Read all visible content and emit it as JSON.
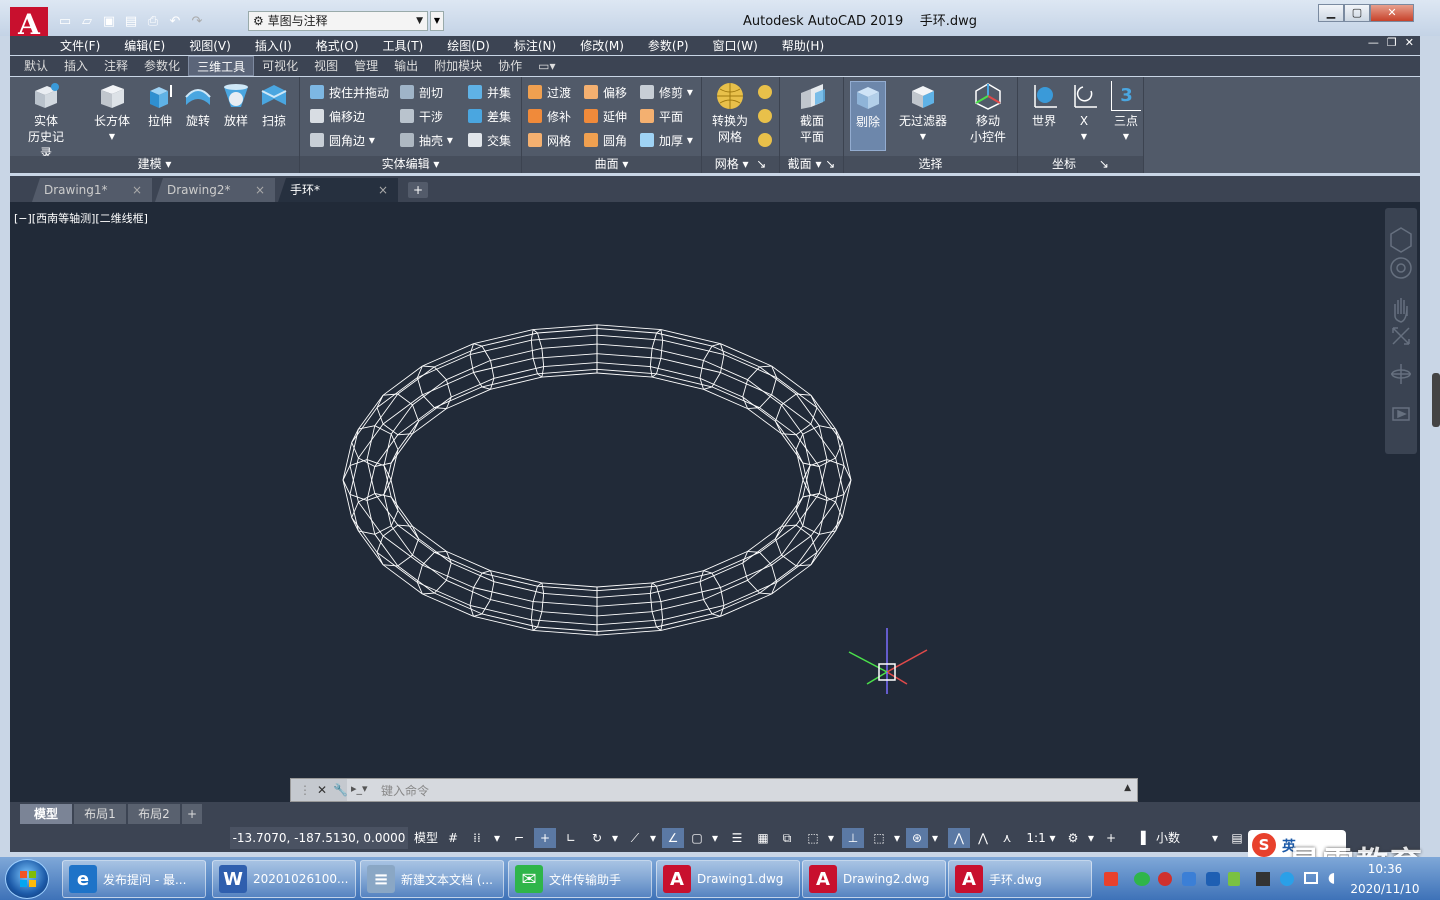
{
  "app": {
    "logo_letter": "A",
    "title": "Autodesk AutoCAD 2019",
    "filename": "手环.dwg",
    "workspace": "草图与注释"
  },
  "menubar": [
    "文件(F)",
    "编辑(E)",
    "视图(V)",
    "插入(I)",
    "格式(O)",
    "工具(T)",
    "绘图(D)",
    "标注(N)",
    "修改(M)",
    "参数(P)",
    "窗口(W)",
    "帮助(H)"
  ],
  "ribbon_tabs": [
    "默认",
    "插入",
    "注释",
    "参数化",
    "三维工具",
    "可视化",
    "视图",
    "管理",
    "输出",
    "附加模块",
    "协作"
  ],
  "ribbon": {
    "modeling": {
      "title": "建模",
      "history_label_1": "实体",
      "history_label_2": "历史记录",
      "box": "长方体",
      "extrude": "拉伸",
      "revolve": "旋转",
      "loft": "放样",
      "sweep": "扫掠"
    },
    "solid_edit": {
      "title": "实体编辑",
      "presspull": "按住并拖动",
      "offset_edge": "偏移边",
      "fillet_edge": "圆角边",
      "slice": "剖切",
      "interfere": "干涉",
      "shell": "抽壳",
      "union": "并集",
      "subtract": "差集",
      "intersect": "交集"
    },
    "surface": {
      "title": "曲面",
      "blend": "过渡",
      "patch": "修补",
      "network": "网格",
      "offset": "偏移",
      "extend": "延伸",
      "fillet": "圆角",
      "trim": "修剪",
      "planar": "平面",
      "thicken": "加厚"
    },
    "mesh": {
      "title": "网格",
      "convert_1": "转换为",
      "convert_2": "网格"
    },
    "section": {
      "title": "截面",
      "plane_1": "截面",
      "plane_2": "平面"
    },
    "selection": {
      "title": "选择",
      "cull": "剔除",
      "no_filter": "无过滤器",
      "gizmo_1": "移动",
      "gizmo_2": "小控件"
    },
    "coordinates": {
      "title": "坐标",
      "world": "世界",
      "x": "X",
      "three_point": "三点",
      "three_glyph": "3"
    }
  },
  "file_tabs": [
    {
      "label": "Drawing1*",
      "close": "×"
    },
    {
      "label": "Drawing2*",
      "close": "×"
    },
    {
      "label": "手环*",
      "close": "×"
    }
  ],
  "tab_add": "+",
  "viewport": {
    "label": "[−][西南等轴测][二维线框]"
  },
  "command": {
    "placeholder": "键入命令",
    "close": "✕"
  },
  "layout_tabs": [
    "模型",
    "布局1",
    "布局2"
  ],
  "layout_add": "+",
  "status": {
    "coords": "-13.7070, -187.5130, 0.0000",
    "model": "模型",
    "scale": "1:1",
    "units": "小数"
  },
  "taskbar": [
    {
      "label": "发布提问 - 最...",
      "icon": "ie-icon",
      "color": "#1e73c8",
      "glyph": "e"
    },
    {
      "label": "20201026100...",
      "icon": "word-icon",
      "color": "#2f5fae",
      "glyph": "W"
    },
    {
      "label": "新建文本文档 (...",
      "icon": "notepad-icon",
      "color": "#8aa7c5",
      "glyph": "≡"
    },
    {
      "label": "文件传输助手",
      "icon": "wechat-icon",
      "color": "#2fb54a",
      "glyph": "✉"
    },
    {
      "label": "Drawing1.dwg",
      "icon": "autocad-icon",
      "color": "#c8102e",
      "glyph": "A"
    },
    {
      "label": "Drawing2.dwg",
      "icon": "autocad-icon",
      "color": "#c8102e",
      "glyph": "A"
    },
    {
      "label": "手环.dwg",
      "icon": "autocad-icon",
      "color": "#c8102e",
      "glyph": "A"
    }
  ],
  "clock": {
    "time": "10:36",
    "date": "2020/11/10"
  },
  "watermark": "最需教育",
  "ime": "英",
  "colors": {
    "accent": "#c8102e",
    "ribbon": "#515a69",
    "viewport": "#212a38",
    "wire": "#ffffff"
  }
}
